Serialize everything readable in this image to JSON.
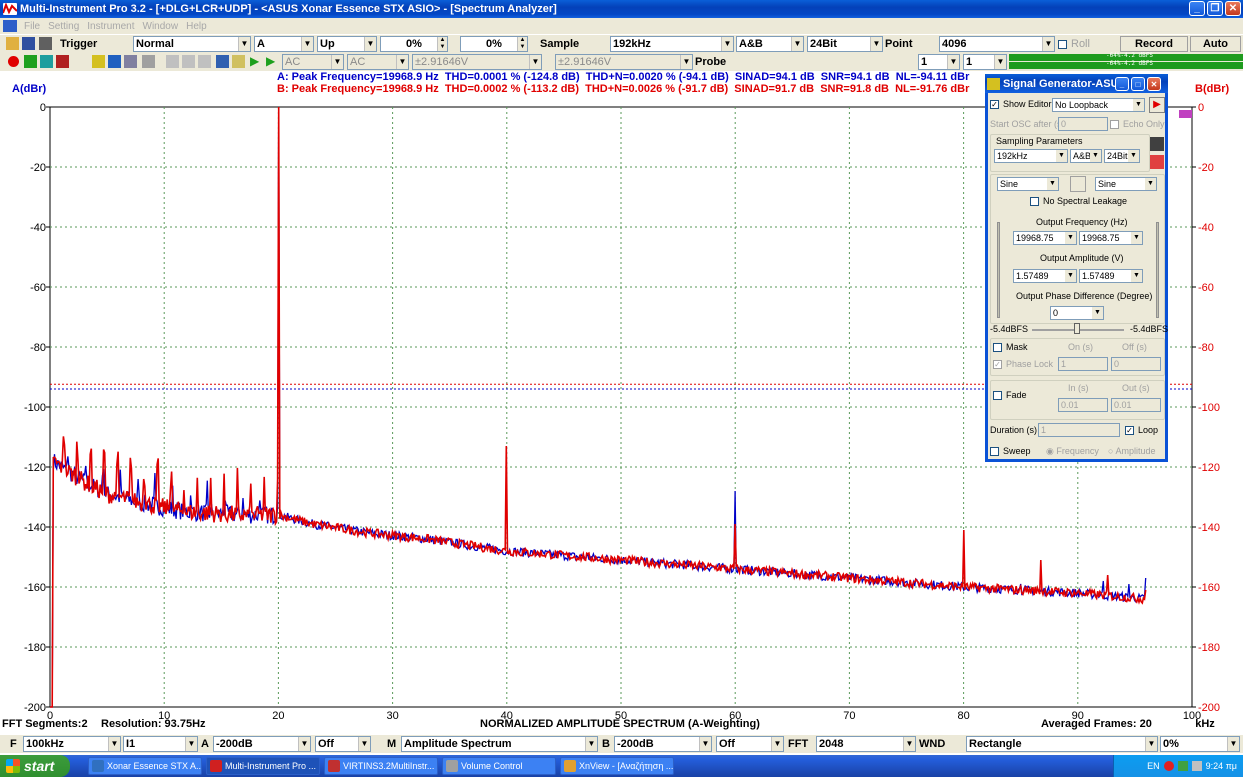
{
  "window": {
    "title": "Multi-Instrument Pro 3.2   - [+DLG+LCR+UDP]   - <ASUS Xonar Essence STX ASIO> - [Spectrum Analyzer]"
  },
  "menu": [
    "File",
    "Setting",
    "Instrument",
    "Window",
    "Help"
  ],
  "toolbar1": {
    "trigger_label": "Trigger",
    "trigger_mode": "Normal",
    "channel": "A",
    "edge": "Up",
    "pct1": "0%",
    "pct2": "0%",
    "sample_label": "Sample",
    "sample_rate": "192kHz",
    "channels": "A&B",
    "bits": "24Bit",
    "point_label": "Point",
    "points": "4096",
    "roll_label": "Roll",
    "record_label": "Record",
    "auto_label": "Auto"
  },
  "toolbar2": {
    "coupling_a": "AC",
    "coupling_b": "AC",
    "range_a": "±2.91646V",
    "range_b": "±2.91646V",
    "probe_label": "Probe",
    "probe_a": "1",
    "probe_b": "1",
    "meter_a": "-64%-4.2 dBFS",
    "meter_b": "-64%-4.2 dBFS"
  },
  "stats": {
    "a": "A: Peak Frequency=19968.9 Hz  THD=0.0001 % (-124.8 dB)  THD+N=0.0020 % (-94.1 dB)  SINAD=94.1 dB  SNR=94.1 dB  NL=-94.11 dBr",
    "b": "B: Peak Frequency=19968.9 Hz  THD=0.0002 % (-113.2 dB)  THD+N=0.0026 % (-91.7 dB)  SINAD=91.7 dB  SNR=91.8 dB  NL=-91.76 dBr"
  },
  "footer": {
    "segments": "FFT Segments:2",
    "resolution": "Resolution: 93.75Hz",
    "mode": "NORMALIZED AMPLITUDE SPECTRUM (A-Weighting)",
    "frames": "Averaged Frames: 20"
  },
  "bottombar": {
    "f_label": "F",
    "freq": "100kHz",
    "f_ch": "I1",
    "a_label": "A",
    "a_floor": "-200dB",
    "a_off": "Off",
    "m_label": "M",
    "m_value": "Amplitude Spectrum",
    "b_label": "B",
    "b_floor": "-200dB",
    "b_off": "Off",
    "fft_label": "FFT",
    "fft_size": "2048",
    "wnd_label": "WND",
    "window": "Rectangle",
    "overlap": "0%"
  },
  "taskbar": {
    "start": "start",
    "tasks": [
      "Xonar Essence STX A...",
      "Multi-Instrument Pro ...",
      "VIRTINS3.2MultiInstr...",
      "Volume Control",
      "XnView - [Αναζήτηση ..."
    ],
    "lang": "EN",
    "time": "9:24 πμ"
  },
  "siggen": {
    "title": "Signal Generator-ASU...",
    "show_editor": "Show Editor",
    "loopback": "No Loopback",
    "start_osc": "Start OSC after (s)",
    "start_osc_val": "0",
    "echo_only": "Echo Only",
    "sampling_params": "Sampling Parameters",
    "rate": "192kHz",
    "ch": "A&B",
    "bits": "24Bit",
    "wave_a": "Sine",
    "wave_b": "Sine",
    "no_leakage": "No Spectral Leakage",
    "out_freq_label": "Output Frequency (Hz)",
    "freq_a": "19968.75",
    "freq_b": "19968.75",
    "out_amp_label": "Output Amplitude (V)",
    "amp_a": "1.57489",
    "amp_b": "1.57489",
    "phase_label": "Output Phase Difference (Degree)",
    "phase": "0",
    "dbfs_a": "-5.4dBFS",
    "dbfs_b": "-5.4dBFS",
    "mask": "Mask",
    "on_s": "On (s)",
    "off_s": "Off (s)",
    "phase_lock": "Phase Lock",
    "on_val": "1",
    "off_val": "0",
    "fade": "Fade",
    "in_s": "In (s)",
    "out_s": "Out (s)",
    "in_val": "0.01",
    "out_val": "0.01",
    "duration": "Duration (s)",
    "duration_val": "1",
    "loop": "Loop",
    "sweep": "Sweep",
    "freq_opt": "Frequency",
    "amp_opt": "Amplitude"
  },
  "colors": {
    "series_a": "#0000c8",
    "series_b": "#e00000",
    "grid": "#5a9a5a"
  },
  "chart_data": {
    "type": "line",
    "xlabel": "kHz",
    "ylabel_left": "A(dBr)",
    "ylabel_right": "B(dBr)",
    "xlim": [
      0,
      100
    ],
    "ylim": [
      -200,
      0
    ],
    "x_ticks": [
      "0",
      "10",
      "20",
      "30",
      "40",
      "50",
      "60",
      "70",
      "80",
      "90",
      "100"
    ],
    "y_ticks": [
      "0",
      "-20",
      "-40",
      "-60",
      "-80",
      "-100",
      "-120",
      "-140",
      "-160",
      "-180",
      "-200"
    ],
    "grid": true,
    "noise_floor": [
      [
        0.3,
        -118
      ],
      [
        1,
        -120
      ],
      [
        3,
        -125
      ],
      [
        5,
        -129
      ],
      [
        8,
        -132
      ],
      [
        12,
        -135
      ],
      [
        17,
        -136
      ],
      [
        20,
        -136
      ],
      [
        23,
        -139
      ],
      [
        28,
        -142
      ],
      [
        33,
        -144
      ],
      [
        40,
        -148
      ],
      [
        50,
        -151
      ],
      [
        60,
        -154
      ],
      [
        70,
        -157
      ],
      [
        80,
        -160
      ],
      [
        90,
        -162
      ],
      [
        96,
        -164
      ]
    ],
    "series": [
      {
        "name": "A",
        "peaks": [
          [
            20,
            0
          ],
          [
            60,
            -128
          ],
          [
            79.9,
            -160
          ],
          [
            85,
            -159
          ],
          [
            92.2,
            -158
          ],
          [
            94.5,
            -159
          ],
          [
            95.9,
            -157
          ]
        ]
      },
      {
        "name": "B",
        "peaks": [
          [
            20,
            0
          ],
          [
            40,
            -113
          ],
          [
            60,
            -139
          ],
          [
            80,
            -141
          ],
          [
            86.8,
            -151
          ],
          [
            92.6,
            -156
          ],
          [
            95.9,
            -161
          ]
        ]
      }
    ],
    "threshold_lines": [
      -92.4,
      -94
    ]
  }
}
